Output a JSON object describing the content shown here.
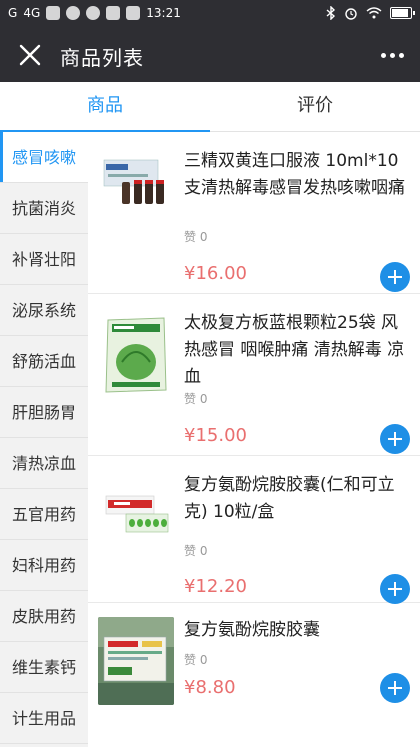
{
  "status_bar": {
    "carrier": "G",
    "network": "4G",
    "time": "13:21"
  },
  "nav": {
    "title": "商品列表",
    "close_icon": "close-icon",
    "more_icon": "more-dots-icon"
  },
  "tabs": [
    {
      "label": "商品",
      "active": true
    },
    {
      "label": "评价",
      "active": false
    }
  ],
  "sidebar": {
    "items": [
      {
        "label": "感冒咳嗽",
        "active": true
      },
      {
        "label": "抗菌消炎"
      },
      {
        "label": "补肾壮阳"
      },
      {
        "label": "泌尿系统"
      },
      {
        "label": "舒筋活血"
      },
      {
        "label": "肝胆肠胃"
      },
      {
        "label": "清热凉血"
      },
      {
        "label": "五官用药"
      },
      {
        "label": "妇科用药"
      },
      {
        "label": "皮肤用药"
      },
      {
        "label": "维生素钙"
      },
      {
        "label": "计生用品"
      }
    ]
  },
  "products": [
    {
      "name": "三精双黄连口服液 10ml*10支清热解毒感冒发热咳嗽咽痛",
      "likes": "赞 0",
      "price": "¥16.00"
    },
    {
      "name": "太极复方板蓝根颗粒25袋 风热感冒 咽喉肿痛 清热解毒 凉血",
      "likes": "赞 0",
      "price": "¥15.00"
    },
    {
      "name": "复方氨酚烷胺胶囊(仁和可立克) 10粒/盒",
      "likes": "赞 0",
      "price": "¥12.20"
    },
    {
      "name": "复方氨酚烷胺胶囊",
      "likes": "赞 0",
      "price": "¥8.80"
    }
  ],
  "colors": {
    "accent": "#2196f3",
    "price": "#e96f6f",
    "header_bg": "#2e2e33"
  }
}
